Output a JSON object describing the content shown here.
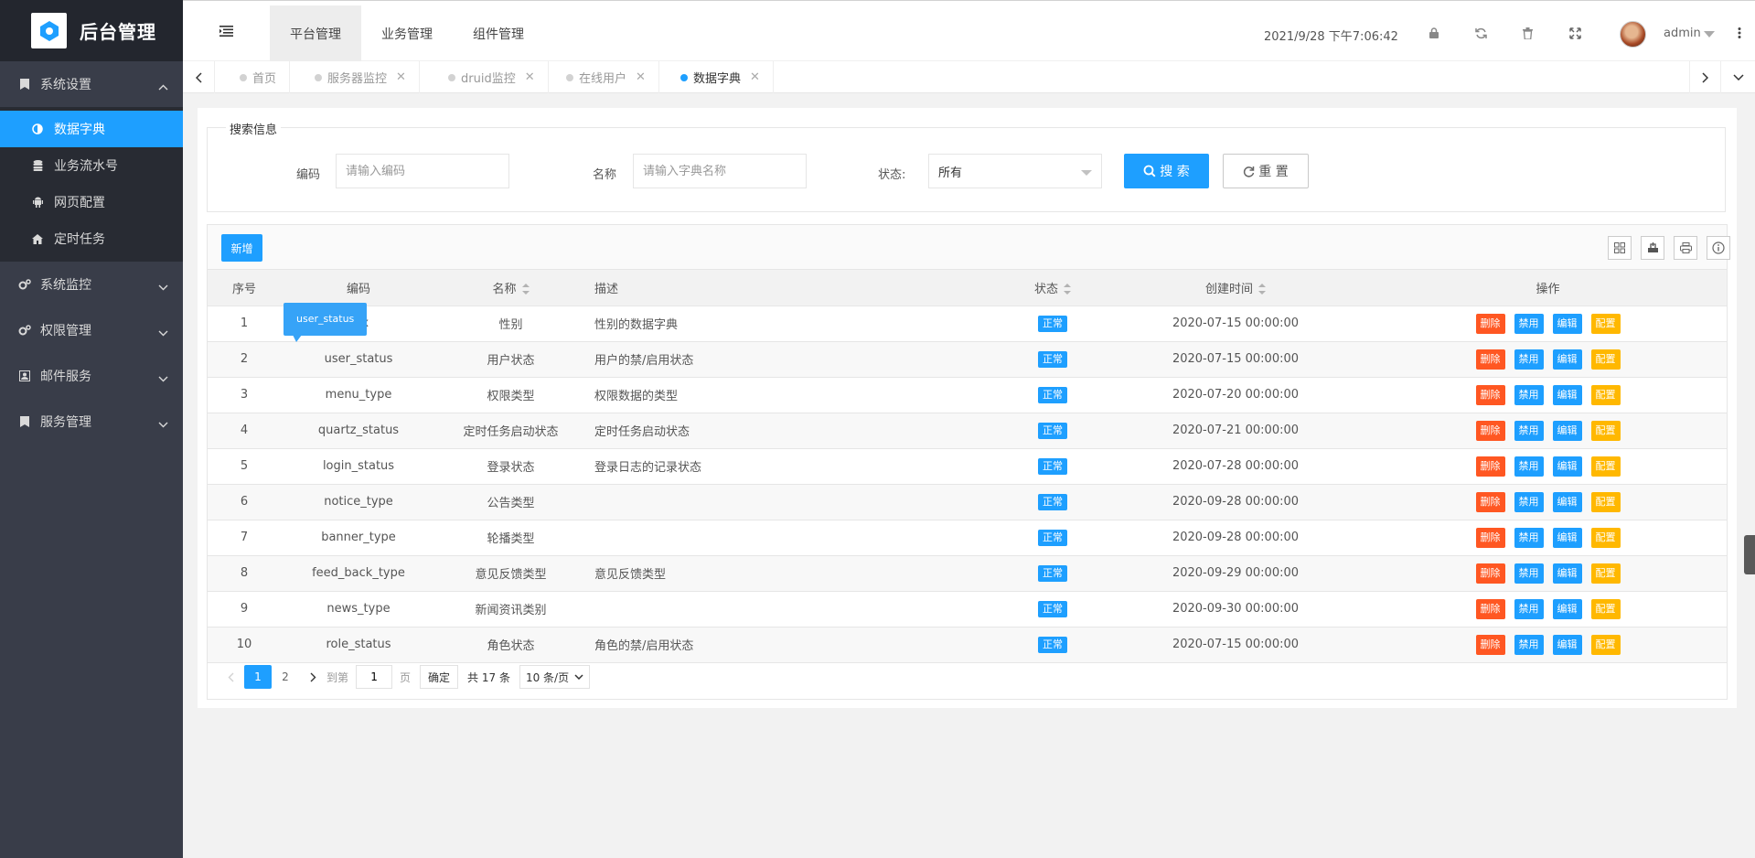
{
  "app": {
    "title": "后台管理"
  },
  "sidebar": {
    "groups": [
      {
        "label": "系统设置",
        "expanded": true,
        "icon": "bookmark-icon",
        "items": [
          {
            "label": "数据字典",
            "icon": "half-circle-icon",
            "active": true
          },
          {
            "label": "业务流水号",
            "icon": "database-icon"
          },
          {
            "label": "网页配置",
            "icon": "android-icon"
          },
          {
            "label": "定时任务",
            "icon": "home-icon"
          }
        ]
      },
      {
        "label": "系统监控",
        "icon": "gears-icon"
      },
      {
        "label": "权限管理",
        "icon": "gears-icon"
      },
      {
        "label": "邮件服务",
        "icon": "contact-icon"
      },
      {
        "label": "服务管理",
        "icon": "bookmark-icon"
      }
    ]
  },
  "header": {
    "nav": [
      "平台管理",
      "业务管理",
      "组件管理"
    ],
    "active_nav": 0,
    "time": "2021/9/28 下午7:06:42",
    "user": "admin"
  },
  "tabs": [
    {
      "label": "首页",
      "closable": false
    },
    {
      "label": "服务器监控",
      "closable": true
    },
    {
      "label": "druid监控",
      "closable": true
    },
    {
      "label": "在线用户",
      "closable": true
    },
    {
      "label": "数据字典",
      "closable": true,
      "active": true
    }
  ],
  "search": {
    "legend": "搜索信息",
    "code_label": "编码",
    "code_placeholder": "请输入编码",
    "name_label": "名称",
    "name_placeholder": "请输入字典名称",
    "status_label": "状态:",
    "status_value": "所有",
    "search_btn": "搜 索",
    "reset_btn": "重 置"
  },
  "toolbar": {
    "add_label": "新增"
  },
  "table": {
    "columns": [
      "序号",
      "编码",
      "名称",
      "描述",
      "状态",
      "创建时间",
      "操作"
    ],
    "actions": [
      "删除",
      "禁用",
      "编辑",
      "配置"
    ],
    "rows": [
      {
        "no": "1",
        "code": "sex",
        "name": "性别",
        "desc": "性别的数据字典",
        "status": "正常",
        "created": "2020-07-15 00:00:00"
      },
      {
        "no": "2",
        "code": "user_status",
        "name": "用户状态",
        "desc": "用户的禁/启用状态",
        "status": "正常",
        "created": "2020-07-15 00:00:00"
      },
      {
        "no": "3",
        "code": "menu_type",
        "name": "权限类型",
        "desc": "权限数据的类型",
        "status": "正常",
        "created": "2020-07-20 00:00:00"
      },
      {
        "no": "4",
        "code": "quartz_status",
        "name": "定时任务启动状态",
        "desc": "定时任务启动状态",
        "status": "正常",
        "created": "2020-07-21 00:00:00"
      },
      {
        "no": "5",
        "code": "login_status",
        "name": "登录状态",
        "desc": "登录日志的记录状态",
        "status": "正常",
        "created": "2020-07-28 00:00:00"
      },
      {
        "no": "6",
        "code": "notice_type",
        "name": "公告类型",
        "desc": "",
        "status": "正常",
        "created": "2020-09-28 00:00:00"
      },
      {
        "no": "7",
        "code": "banner_type",
        "name": "轮播类型",
        "desc": "",
        "status": "正常",
        "created": "2020-09-28 00:00:00"
      },
      {
        "no": "8",
        "code": "feed_back_type",
        "name": "意见反馈类型",
        "desc": "意见反馈类型",
        "status": "正常",
        "created": "2020-09-29 00:00:00"
      },
      {
        "no": "9",
        "code": "news_type",
        "name": "新闻资讯类别",
        "desc": "",
        "status": "正常",
        "created": "2020-09-30 00:00:00"
      },
      {
        "no": "10",
        "code": "role_status",
        "name": "角色状态",
        "desc": "角色的禁/启用状态",
        "status": "正常",
        "created": "2020-07-15 00:00:00"
      }
    ]
  },
  "pager": {
    "pages": [
      "1",
      "2"
    ],
    "current": "1",
    "goto_label": "到第",
    "goto_value": "1",
    "page_unit": "页",
    "confirm": "确定",
    "total": "共 17 条",
    "page_size": "10 条/页"
  },
  "tooltip": {
    "text": "user_status"
  },
  "colors": {
    "primary": "#1e9fff",
    "danger": "#ff5722",
    "warn": "#ffb800",
    "sidebar": "#393d49"
  }
}
